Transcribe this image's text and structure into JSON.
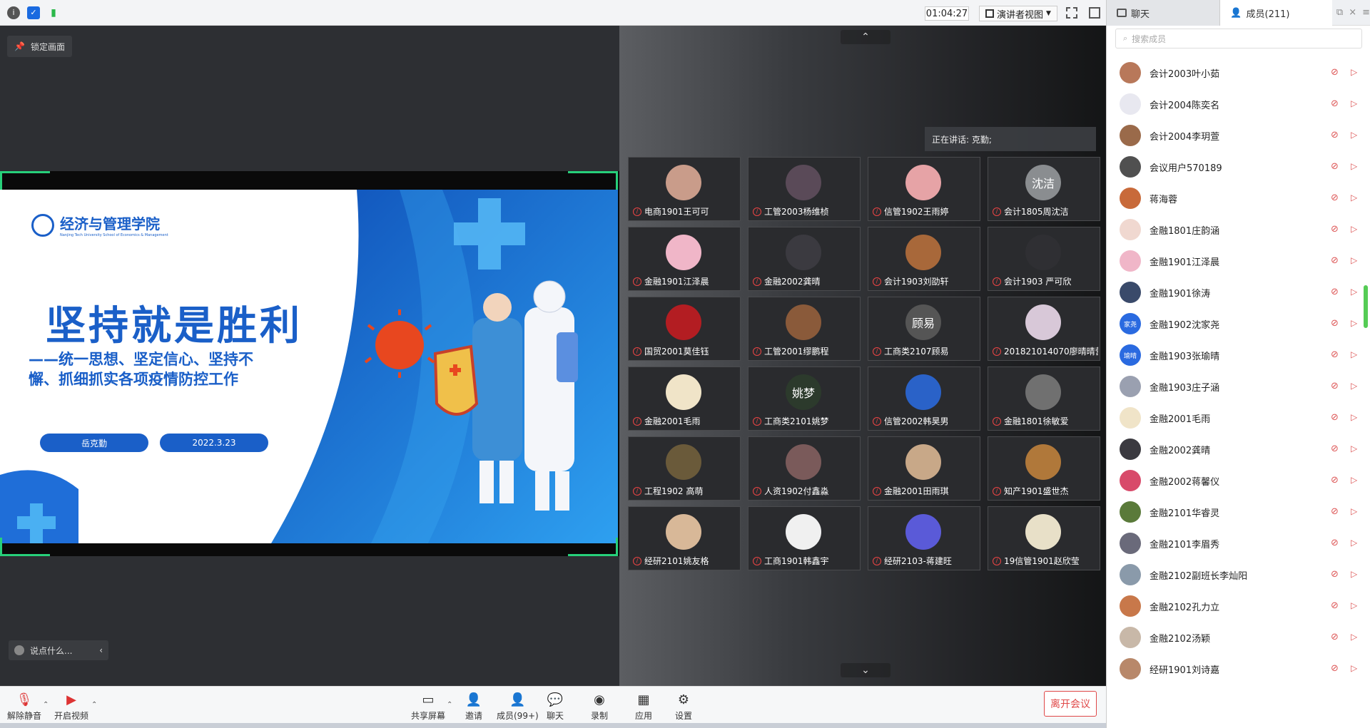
{
  "topbar": {
    "timer": "01:04:27",
    "view_label": "演讲者视图",
    "icons": [
      "info-icon",
      "shield-icon",
      "signal-icon"
    ]
  },
  "left": {
    "lock_label": "锁定画面",
    "chat_placeholder": "说点什么..."
  },
  "slide": {
    "school_name": "经济与管理学院",
    "school_subtitle": "Nanjing Tech University School of Economics & Management",
    "title": "坚持就是胜利",
    "subtitle_line1": "——统一思想、坚定信心、坚持不",
    "subtitle_line2": "懈、抓细抓实各项疫情防控工作",
    "presenter": "岳克勤",
    "date": "2022.3.23"
  },
  "gallery": {
    "speaking_label": "正在讲话: 克勤;",
    "tiles": [
      {
        "name": "电商1901王可可",
        "color": "#c99c8a",
        "av": ""
      },
      {
        "name": "工管2003杨维桢",
        "color": "#5a4a58",
        "av": ""
      },
      {
        "name": "信管1902王雨婷",
        "color": "#e6a3a6",
        "av": ""
      },
      {
        "name": "会计1805周沈洁",
        "color": "#8a8d90",
        "av": "沈洁"
      },
      {
        "name": "金融1901江泽晨",
        "color": "#f0b6c8",
        "av": ""
      },
      {
        "name": "金融2002龚晴",
        "color": "#3b3a40",
        "av": ""
      },
      {
        "name": "会计1903刘劭轩",
        "color": "#a8683a",
        "av": ""
      },
      {
        "name": "会计1903 严可欣",
        "color": "#2f2f33",
        "av": ""
      },
      {
        "name": "国贸2001莫佳钰",
        "color": "#b31d22",
        "av": ""
      },
      {
        "name": "工管2001缪鹏程",
        "color": "#8a5a3a",
        "av": ""
      },
      {
        "name": "工商类2107顾易",
        "color": "#555",
        "av": "顾易"
      },
      {
        "name": "201821014070廖晴晴营销1...",
        "color": "#d8c8d8",
        "av": ""
      },
      {
        "name": "金融2001毛雨",
        "color": "#f0e4c8",
        "av": ""
      },
      {
        "name": "工商类2101姚梦",
        "color": "#2c3a2c",
        "av": "姚梦"
      },
      {
        "name": "信管2002韩昊男",
        "color": "#2a62c8",
        "av": ""
      },
      {
        "name": "金融1801徐敏爱",
        "color": "#707070",
        "av": ""
      },
      {
        "name": "工程1902 高萌",
        "color": "#6a5a3a",
        "av": ""
      },
      {
        "name": "人资1902付鑫淼",
        "color": "#7a5a5a",
        "av": ""
      },
      {
        "name": "金融2001田雨琪",
        "color": "#c8a888",
        "av": ""
      },
      {
        "name": "知产1901盛世杰",
        "color": "#b0783a",
        "av": ""
      },
      {
        "name": "经研2101姚友格",
        "color": "#d8b898",
        "av": ""
      },
      {
        "name": "工商1901韩鑫宇",
        "color": "#f0f0f0",
        "av": ""
      },
      {
        "name": "经研2103-蒋建旺",
        "color": "#5a5ad8",
        "av": ""
      },
      {
        "name": "19信管1901赵欣莹",
        "color": "#e8e0c8",
        "av": ""
      }
    ]
  },
  "right": {
    "tab_chat": "聊天",
    "tab_members": "成员(211)",
    "search_placeholder": "搜索成员",
    "members": [
      {
        "name": "会计2003叶小茹",
        "color": "#b8785a",
        "av": ""
      },
      {
        "name": "会计2004陈奕名",
        "color": "#e8e8f0",
        "av": ""
      },
      {
        "name": "会计2004李玥萱",
        "color": "#9a6a4a",
        "av": ""
      },
      {
        "name": "会议用户570189",
        "color": "#505050",
        "av": ""
      },
      {
        "name": "蒋海蓉",
        "color": "#c86a3a",
        "av": ""
      },
      {
        "name": "金融1801庄韵涵",
        "color": "#f0d8d0",
        "av": ""
      },
      {
        "name": "金融1901江泽晨",
        "color": "#f0b6c8",
        "av": ""
      },
      {
        "name": "金融1901徐涛",
        "color": "#3a4a6a",
        "av": ""
      },
      {
        "name": "金融1902沈家尧",
        "color": "#2a6ae0",
        "av": "家尧"
      },
      {
        "name": "金融1903张瑜晴",
        "color": "#2a6ae0",
        "av": "瑜晴"
      },
      {
        "name": "金融1903庄子涵",
        "color": "#9aa0b0",
        "av": ""
      },
      {
        "name": "金融2001毛雨",
        "color": "#f0e4c8",
        "av": ""
      },
      {
        "name": "金融2002龚晴",
        "color": "#3b3a40",
        "av": ""
      },
      {
        "name": "金融2002蒋馨仪",
        "color": "#d84a6a",
        "av": ""
      },
      {
        "name": "金融2101华睿灵",
        "color": "#5a7a3a",
        "av": ""
      },
      {
        "name": "金融2101李眉秀",
        "color": "#6a6a7a",
        "av": ""
      },
      {
        "name": "金融2102副班长李灿阳",
        "color": "#8a9aaa",
        "av": ""
      },
      {
        "name": "金融2102孔力立",
        "color": "#c8784a",
        "av": ""
      },
      {
        "name": "金融2102汤颖",
        "color": "#c8b8a8",
        "av": ""
      },
      {
        "name": "经研1901刘诗嘉",
        "color": "#b8886a",
        "av": ""
      }
    ]
  },
  "bottombar": {
    "unmute": "解除静音",
    "start_video": "开启视频",
    "share_screen": "共享屏幕",
    "invite": "邀请",
    "members": "成员(99+)",
    "chat": "聊天",
    "record": "录制",
    "apps": "应用",
    "settings": "设置",
    "leave": "离开会议"
  },
  "colors": {
    "accent_green": "#27d07a",
    "danger_red": "#e04848",
    "slide_blue": "#1a5fc8"
  }
}
